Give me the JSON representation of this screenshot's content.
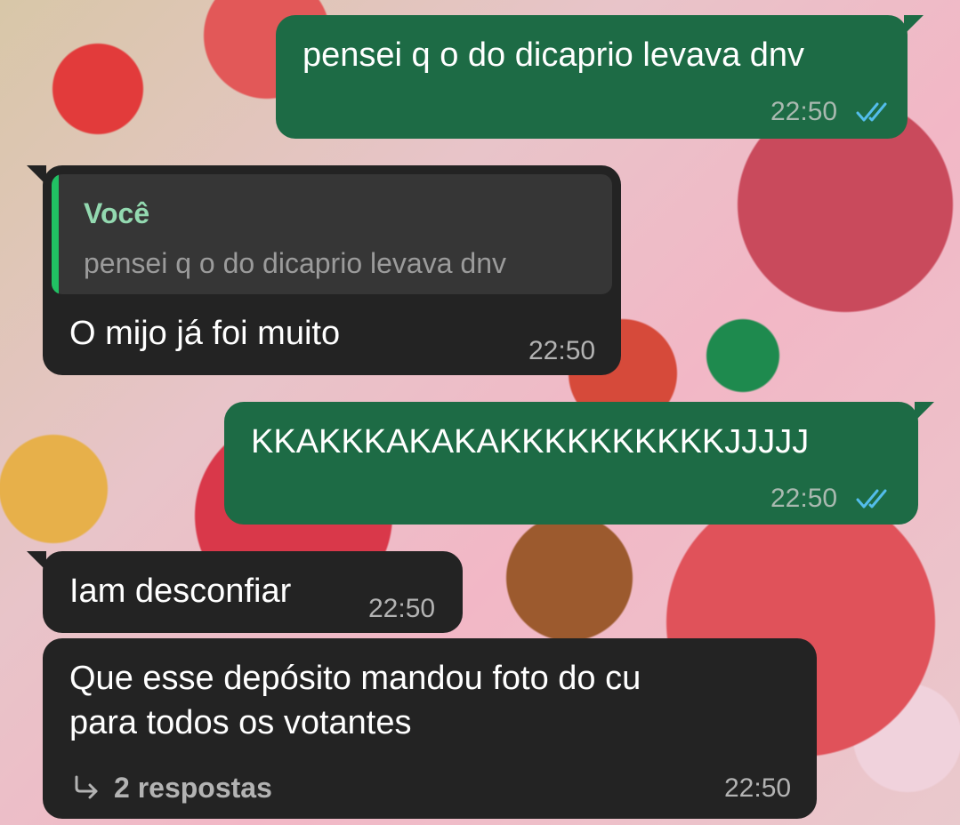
{
  "colors": {
    "outgoing_bubble": "#1d6b45",
    "incoming_bubble": "#232323",
    "quote_accent": "#21c063",
    "read_ticks": "#53bdeb"
  },
  "messages": [
    {
      "direction": "outgoing",
      "text": "pensei q o do dicaprio levava dnv",
      "time": "22:50",
      "status_icon": "double-check-read-icon"
    },
    {
      "direction": "incoming",
      "quote": {
        "author": "Você",
        "text": "pensei q o do dicaprio levava dnv"
      },
      "text": "O mijo já foi muito",
      "time": "22:50"
    },
    {
      "direction": "outgoing",
      "text": "KKAKKKAKAKAKKKKKKKKKKJJJJJ",
      "time": "22:50",
      "status_icon": "double-check-read-icon"
    },
    {
      "direction": "incoming",
      "text": "Iam desconfiar",
      "time": "22:50"
    },
    {
      "direction": "incoming",
      "text_lines": [
        "Que esse depósito mandou foto do cu",
        "para todos os votantes"
      ],
      "time": "22:50",
      "replies_icon": "reply-arrow-icon",
      "replies_label": "2 respostas"
    }
  ]
}
